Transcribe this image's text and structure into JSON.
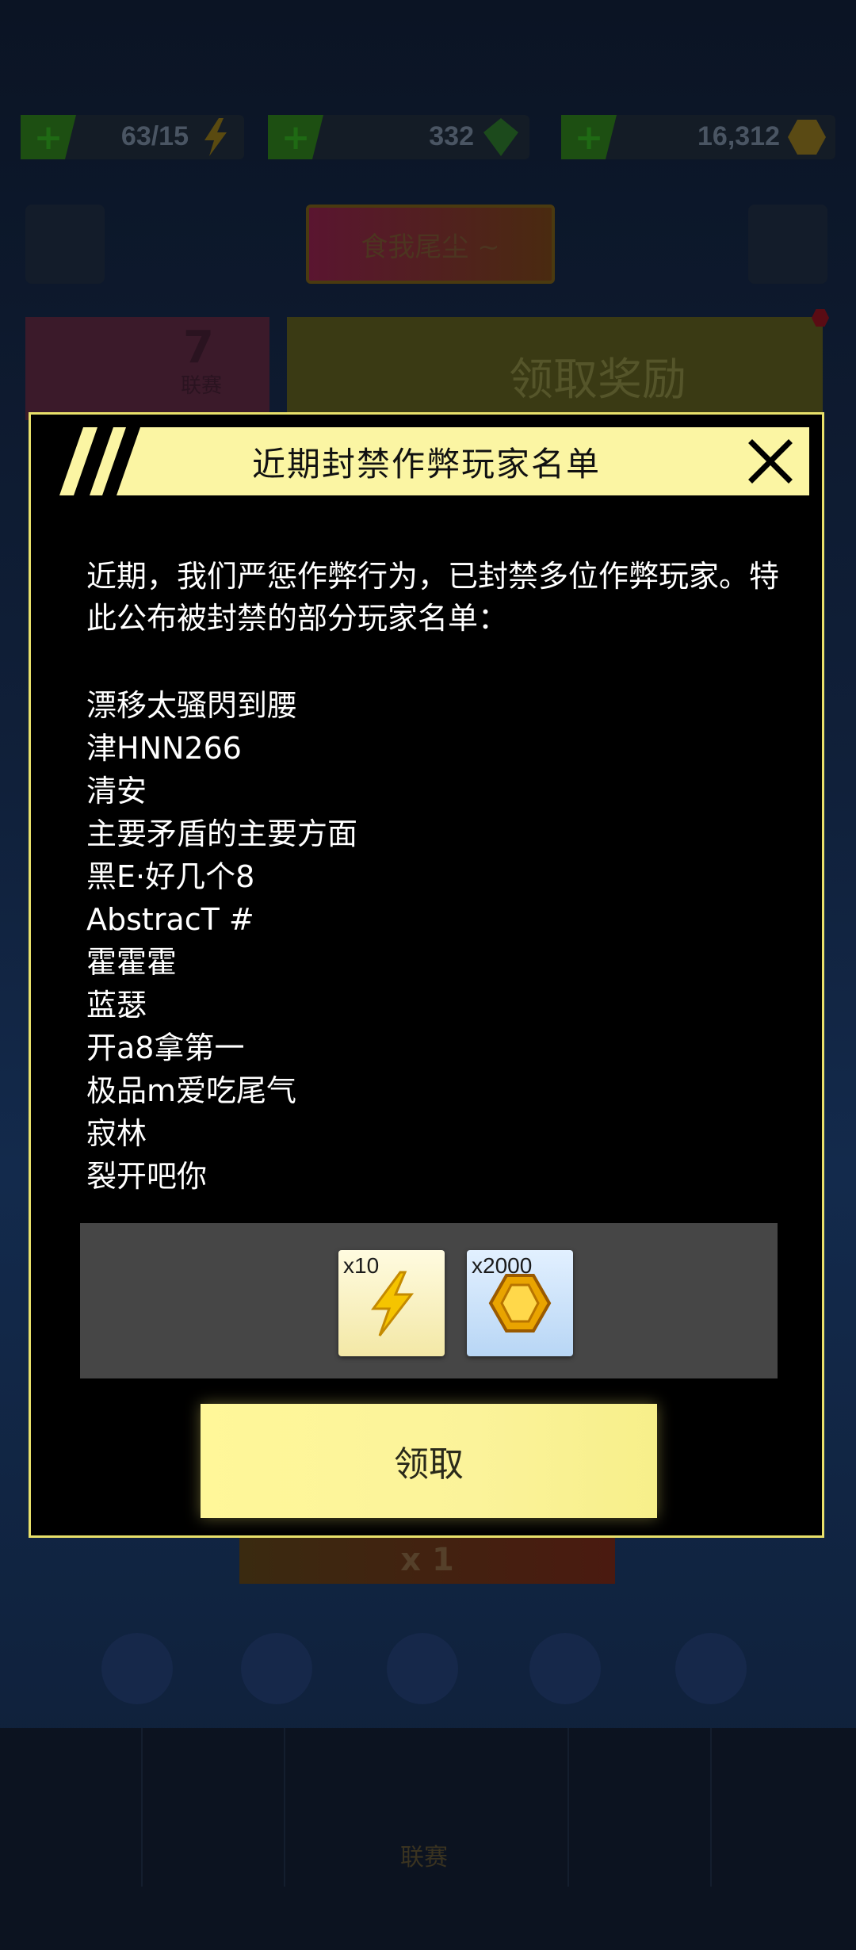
{
  "background": {
    "resources": [
      {
        "value": "63/15",
        "icon": "lightning-icon"
      },
      {
        "value": "332",
        "icon": "green-gem-icon"
      },
      {
        "value": "16,312",
        "icon": "coin-icon"
      }
    ],
    "player_name": "食我尾尘 ~",
    "league": {
      "number": "7",
      "label": "联赛"
    },
    "reward_banner": "领取奖励",
    "multiplier": "x 1",
    "nav_label": "联赛"
  },
  "modal": {
    "title": "近期封禁作弊玩家名单",
    "intro": "近期，我们严惩作弊行为，已封禁多位作弊玩家。特此公布被封禁的部分玩家名单：",
    "banned_players": [
      "漂移太骚閃到腰",
      "津HNN266",
      "清安",
      "主要矛盾的主要方面",
      "黑E·好几个8",
      "AbstracT #",
      "霍霍霍",
      "蓝瑟",
      "开a8拿第一",
      "极品m爱吃尾气",
      "寂林",
      "裂开吧你"
    ],
    "rewards": [
      {
        "count": "x10",
        "icon": "lightning-icon"
      },
      {
        "count": "x2000",
        "icon": "gold-coin-icon"
      }
    ],
    "claim_label": "领取"
  },
  "colors": {
    "accent_yellow": "#fbf5a3",
    "border_yellow": "#e8e06a",
    "modal_bg": "#000000"
  }
}
